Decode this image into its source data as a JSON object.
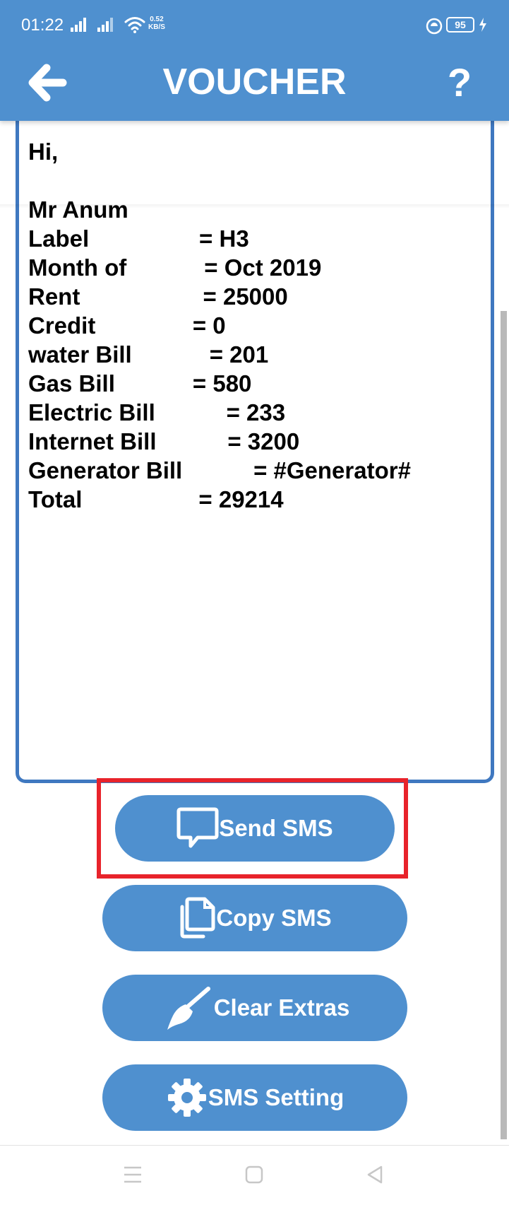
{
  "status_bar": {
    "time": "01:22",
    "net_speed_value": "0.52",
    "net_speed_unit": "KB/S",
    "battery": "95"
  },
  "header": {
    "title": "VOUCHER",
    "help_label": "?"
  },
  "message": {
    "text": "Hi,\n\nMr Anum\nLabel                 = H3\nMonth of            = Oct 2019\nRent                   = 25000\nCredit               = 0\nwater Bill            = 201\nGas Bill            = 580\nElectric Bill           = 233\nInternet Bill           = 3200\nGenerator Bill           = #Generator#\nTotal                  = 29214"
  },
  "buttons": {
    "send_sms": "Send SMS",
    "copy_sms": "Copy SMS",
    "clear_extras": "Clear Extras",
    "sms_setting": "SMS Setting"
  },
  "colors": {
    "primary": "#4f90cf",
    "field_border": "#3f78c0",
    "highlight": "#e8232b"
  },
  "icons": {
    "back": "arrow-left-icon",
    "send": "chat-bubble-icon",
    "copy": "copy-icon",
    "clear": "brush-icon",
    "setting": "gear-icon"
  }
}
